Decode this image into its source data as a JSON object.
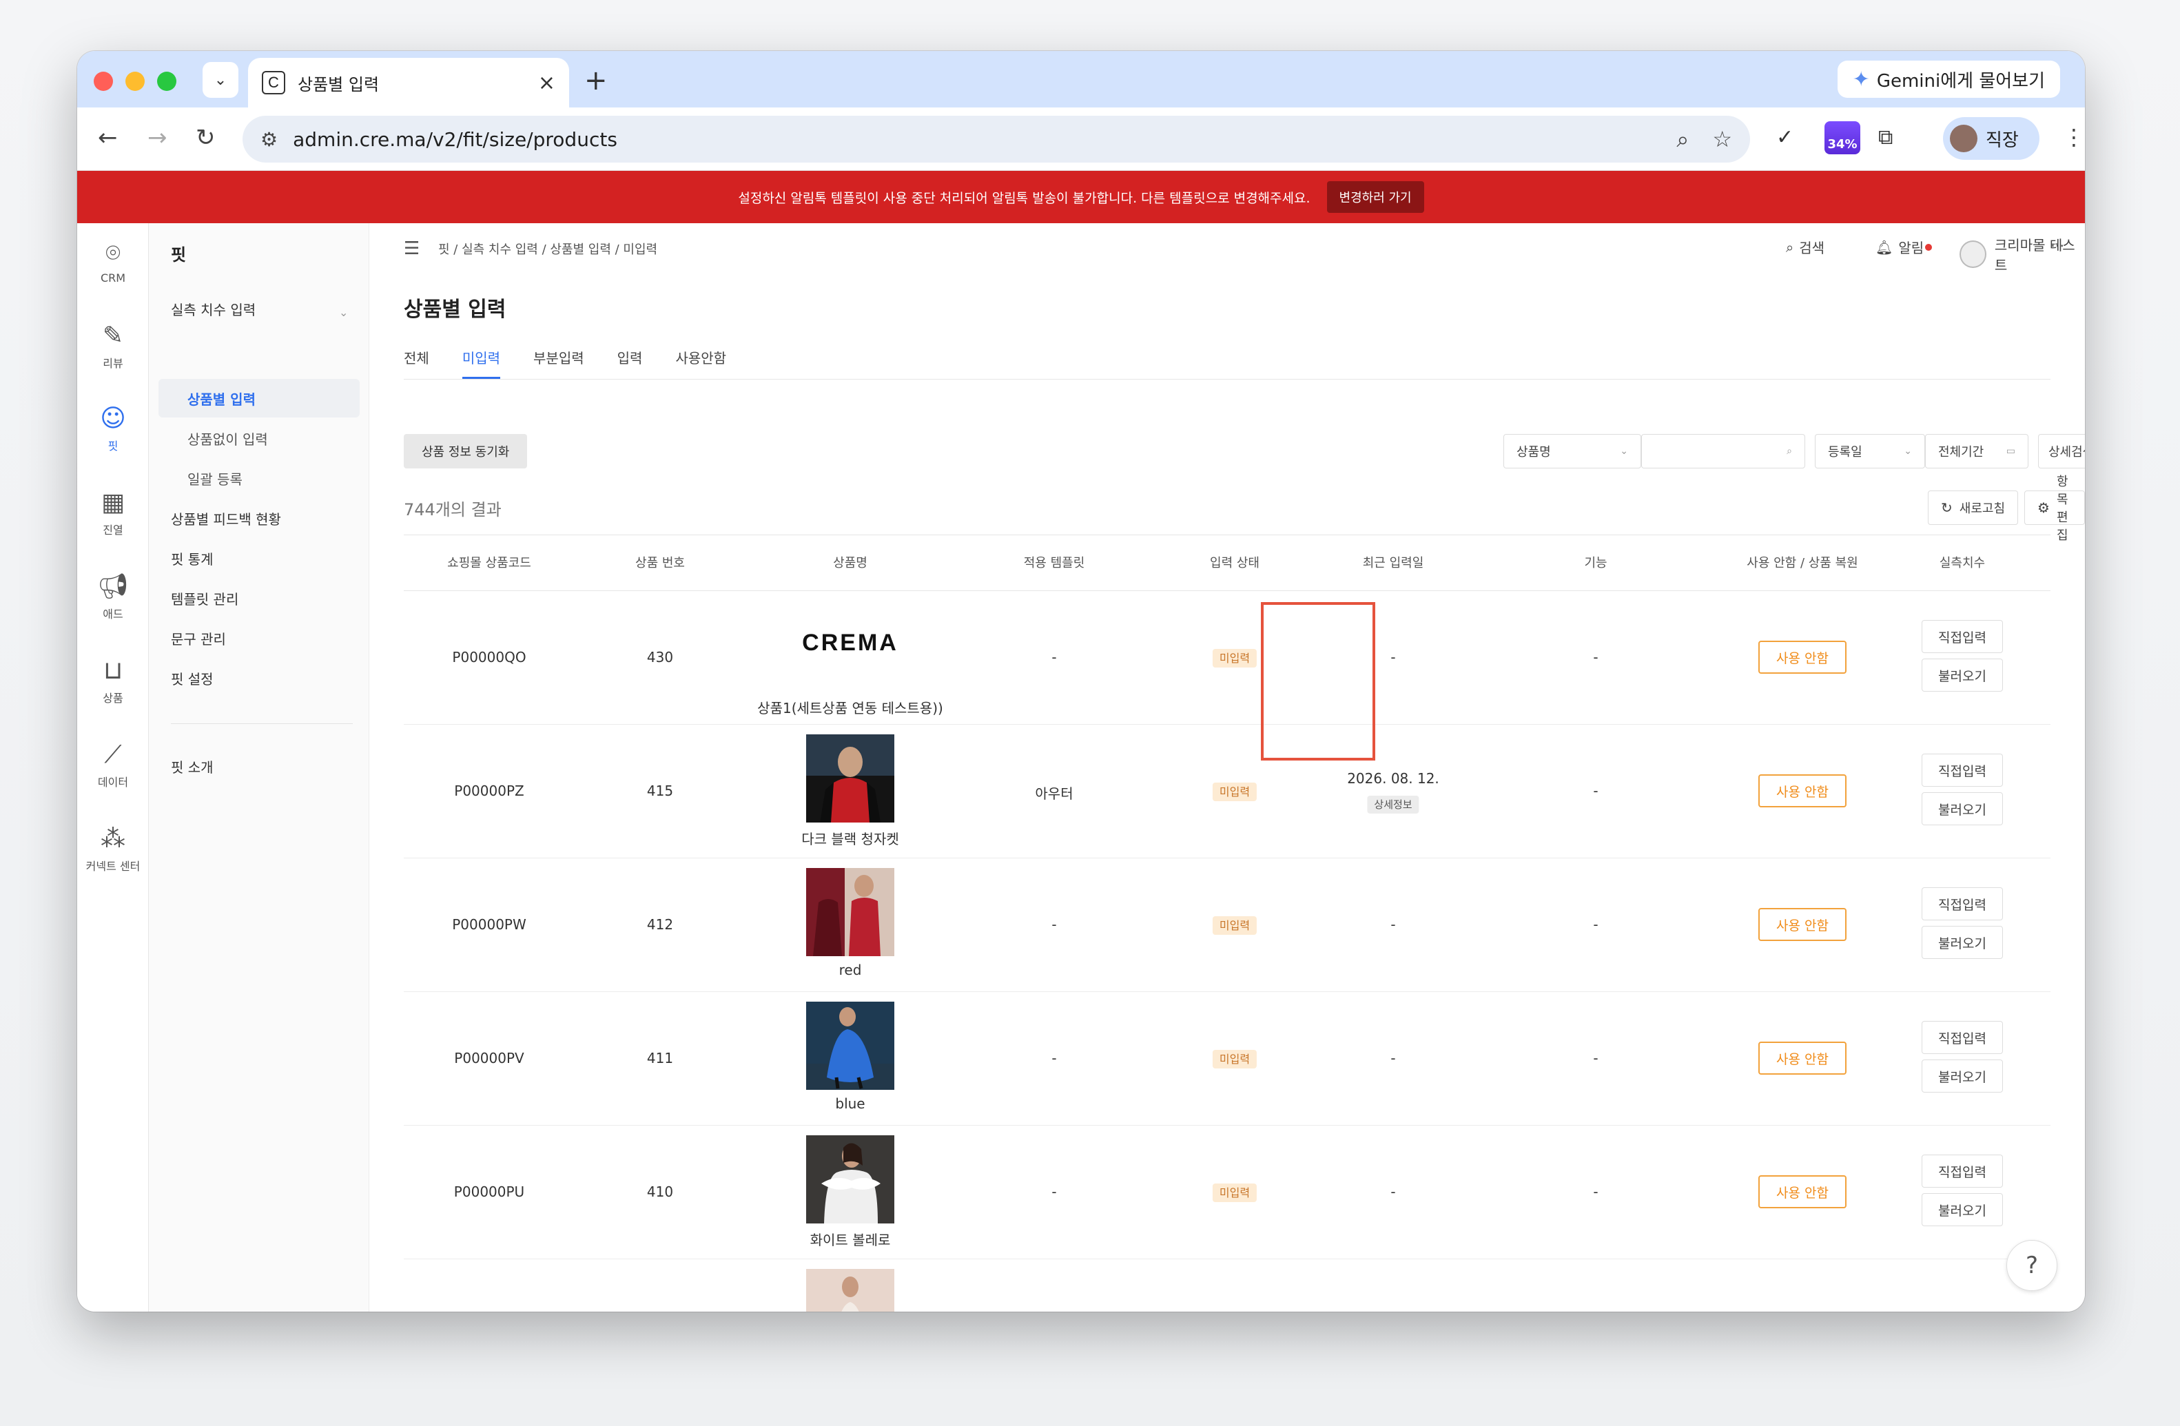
{
  "browser": {
    "tab_title": "상품별 입력",
    "tab_favicon": "C",
    "url": "admin.cre.ma/v2/fit/size/products",
    "gemini_label": "Gemini에게 물어보기",
    "profile_label": "직장",
    "ext_badge": "34%"
  },
  "banner": {
    "message": "설정하신 알림톡 템플릿이 사용 중단 처리되어 알림톡 발송이 불가합니다. 다른 템플릿으로 변경해주세요.",
    "button": "변경하러 가기"
  },
  "rail": [
    {
      "icon": "location-pin-icon",
      "label": "CRM"
    },
    {
      "icon": "edit-icon",
      "label": "리뷰"
    },
    {
      "icon": "user-check-icon",
      "label": "핏"
    },
    {
      "icon": "grid-icon",
      "label": "진열"
    },
    {
      "icon": "megaphone-icon",
      "label": "애드"
    },
    {
      "icon": "shopping-bag-icon",
      "label": "상품"
    },
    {
      "icon": "line-chart-icon",
      "label": "데이터"
    },
    {
      "icon": "connect-icon",
      "label": "커넥트 센터"
    }
  ],
  "sidebar": {
    "title": "핏",
    "group": "실측 치수 입력",
    "sub_items": [
      "상품별 입력",
      "상품없이 입력",
      "일괄 등록"
    ],
    "items": [
      "상품별 피드백 현황",
      "핏 통계",
      "템플릿 관리",
      "문구 관리",
      "핏 설정"
    ],
    "footer_item": "핏 소개"
  },
  "topbar": {
    "breadcrumb": "핏 / 실측 치수 입력 / 상품별 입력 / 미입력",
    "search": "검색",
    "alerts": "알림",
    "user": "크리마몰 테스트"
  },
  "page": {
    "title": "상품별 입력",
    "tabs": [
      "전체",
      "미입력",
      "부분입력",
      "입력",
      "사용안함"
    ],
    "active_tab": "미입력",
    "sync_button": "상품 정보 동기화",
    "filter_field": "상품명",
    "filter_date": "등록일",
    "filter_period": "전체기간",
    "detail_search": "상세검색",
    "result_count": "744개의 결과",
    "refresh": "새로고침",
    "edit_columns": "항목 편집"
  },
  "table": {
    "headers": [
      "쇼핑몰 상품코드",
      "상품 번호",
      "상품명",
      "적용 템플릿",
      "입력 상태",
      "최근 입력일",
      "기능",
      "사용 안함 / 상품 복원",
      "실측치수"
    ],
    "rows": [
      {
        "code": "P00000QO",
        "number": "430",
        "name": "상품1(세트상품 연동 테스트용))",
        "template": "-",
        "status": "미입력",
        "last_input": "-",
        "function": "-",
        "usage": "사용 안함",
        "image": "crema-logo",
        "logo_text": "CREMA"
      },
      {
        "code": "P00000PZ",
        "number": "415",
        "name": "다크 블랙 청자켓",
        "template": "아우터",
        "status": "미입력",
        "last_input": "2026. 08. 12.",
        "detail": "상세정보",
        "function": "-",
        "usage": "사용 안함",
        "image": "photo-red"
      },
      {
        "code": "P00000PW",
        "number": "412",
        "name": "red",
        "template": "-",
        "status": "미입력",
        "last_input": "-",
        "function": "-",
        "usage": "사용 안함",
        "image": "photo-red-dress"
      },
      {
        "code": "P00000PV",
        "number": "411",
        "name": "blue",
        "template": "-",
        "status": "미입력",
        "last_input": "-",
        "function": "-",
        "usage": "사용 안함",
        "image": "photo-blue"
      },
      {
        "code": "P00000PU",
        "number": "410",
        "name": "화이트 볼레로",
        "template": "-",
        "status": "미입력",
        "last_input": "-",
        "function": "-",
        "usage": "사용 안함",
        "image": "photo-white"
      }
    ],
    "direct_input": "직접입력",
    "load": "불러오기"
  },
  "help": "?"
}
